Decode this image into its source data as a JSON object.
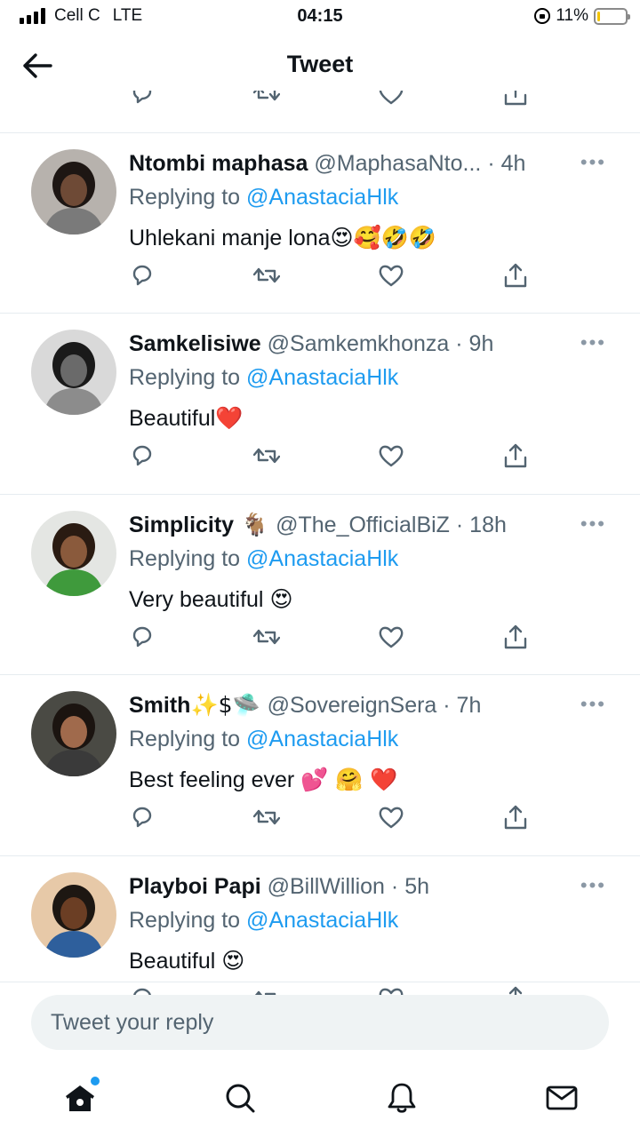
{
  "status_bar": {
    "carrier": "Cell C",
    "network": "LTE",
    "time": "04:15",
    "battery": "11%",
    "battery_level": 0.11
  },
  "header": {
    "title": "Tweet"
  },
  "tweets": [
    {
      "name": "Ntombi maphasa",
      "handle": "@MaphasaNto...",
      "time": "· 4h",
      "replying_label": "Replying to ",
      "replying_to": "@AnastaciaHlk",
      "text": "Uhlekani manje lona",
      "emojis": "😍🥰🤣🤣"
    },
    {
      "name": "Samkelisiwe",
      "handle": "@Samkemkhonza",
      "time": "· 9h",
      "replying_label": "Replying to ",
      "replying_to": "@AnastaciaHlk",
      "text": "Beautiful",
      "emojis": "❤️"
    },
    {
      "name": "Simplicity",
      "name_emoji": " 🐐 ",
      "handle": "@The_OfficialBiZ",
      "time": "· 18h",
      "replying_label": "Replying to ",
      "replying_to": "@AnastaciaHlk",
      "text": "Very beautiful ",
      "emojis": "😍"
    },
    {
      "name": "Smith",
      "name_emoji": "✨$🛸 ",
      "handle": "@SovereignSera",
      "time": "· 7h",
      "replying_label": "Replying to ",
      "replying_to": "@AnastaciaHlk",
      "text": "Best feeling ever ",
      "emojis": "💕 🤗 ❤️"
    },
    {
      "name": "Playboi Papi",
      "handle": "@BillWillion",
      "time": "· 5h",
      "replying_label": "Replying to ",
      "replying_to": "@AnastaciaHlk",
      "text": "Beautiful ",
      "emojis": "😍"
    }
  ],
  "more_label": "•••",
  "reply_box": {
    "placeholder": "Tweet your reply"
  },
  "tabs": [
    "home-icon",
    "search-icon",
    "notifications-icon",
    "messages-icon"
  ],
  "colors": {
    "accent": "#1d9bf0",
    "secondary_text": "#536471",
    "icon_gray": "#536471"
  }
}
